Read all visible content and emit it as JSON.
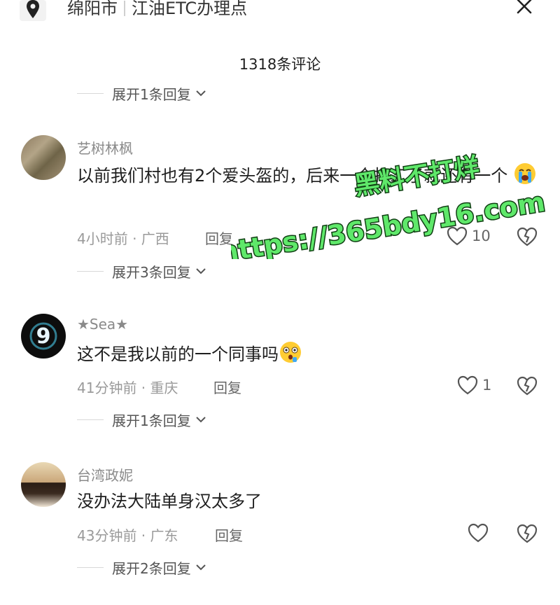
{
  "location": {
    "city": "绵阳市",
    "place": "江油ETC办理点"
  },
  "comments_count": "1318条评论",
  "top_partial_expand": "展开1条回复",
  "comments": [
    {
      "name": "艺树林枫",
      "text_before_emoji": "以前我们村也有2个爱头盔的，后来一个打工了就还有一个",
      "emoji": "crying-face",
      "time": "4小时前 · 广西",
      "reply": "回复",
      "likes": "10",
      "expand": "展开3条回复"
    },
    {
      "name": "★Sea★",
      "text_before_emoji": "这不是我以前的一个同事吗",
      "emoji": "shocked-face",
      "time": "41分钟前 · 重庆",
      "reply": "回复",
      "likes": "1",
      "expand": "展开1条回复"
    },
    {
      "name": "台湾政妮",
      "text_before_emoji": "没办法大陆单身汉太多了",
      "emoji": "",
      "time": "43分钟前 · 广东",
      "reply": "回复",
      "likes": "",
      "expand": "展开2条回复"
    }
  ],
  "watermark": {
    "line1": "黑料不打烊",
    "line2": "https://365bdy16.com"
  },
  "colors": {
    "watermark_fill": "#5fe86a",
    "watermark_stroke": "#0f3d12"
  },
  "icons": [
    "location-pin-icon",
    "close-icon",
    "heart-icon",
    "dislike-heart-icon",
    "chevron-down-icon"
  ]
}
